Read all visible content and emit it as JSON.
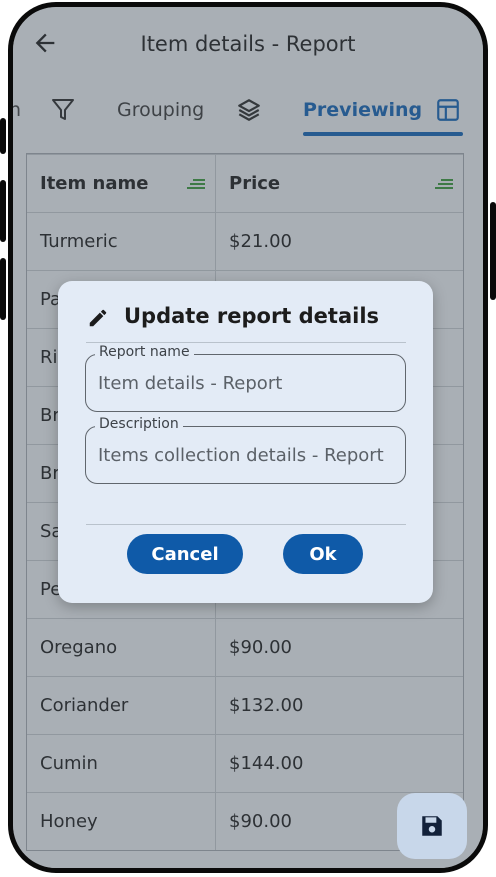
{
  "appbar": {
    "title": "Item details - Report"
  },
  "tabs": [
    {
      "label": "n"
    },
    {
      "label": "Grouping"
    },
    {
      "label": "Previewing"
    }
  ],
  "table": {
    "headers": [
      "Item name",
      "Price"
    ],
    "rows": [
      [
        "Turmeric",
        "$21.00"
      ],
      [
        "Pa",
        ""
      ],
      [
        "Ri",
        ""
      ],
      [
        "Br",
        ""
      ],
      [
        "Br",
        ""
      ],
      [
        "Sa",
        ""
      ],
      [
        "Pe",
        ""
      ],
      [
        "Oregano",
        "$90.00"
      ],
      [
        "Coriander",
        "$132.00"
      ],
      [
        "Cumin",
        "$144.00"
      ],
      [
        "Honey",
        "$90.00"
      ]
    ]
  },
  "dialog": {
    "title": "Update report details",
    "report_name": {
      "label": "Report name",
      "value": "Item details - Report"
    },
    "description": {
      "label": "Description",
      "value": "Items collection details  - Report"
    },
    "cancel_label": "Cancel",
    "ok_label": "Ok"
  },
  "colors": {
    "accent": "#1264b8",
    "button": "#0f5aa8",
    "sort_icon": "#3a9a3a",
    "dialog_bg": "#e3ebf6"
  },
  "icons": [
    "back-arrow-icon",
    "filter-icon",
    "layers-icon",
    "layout-icon",
    "sort-icon",
    "pencil-icon",
    "save-icon"
  ]
}
